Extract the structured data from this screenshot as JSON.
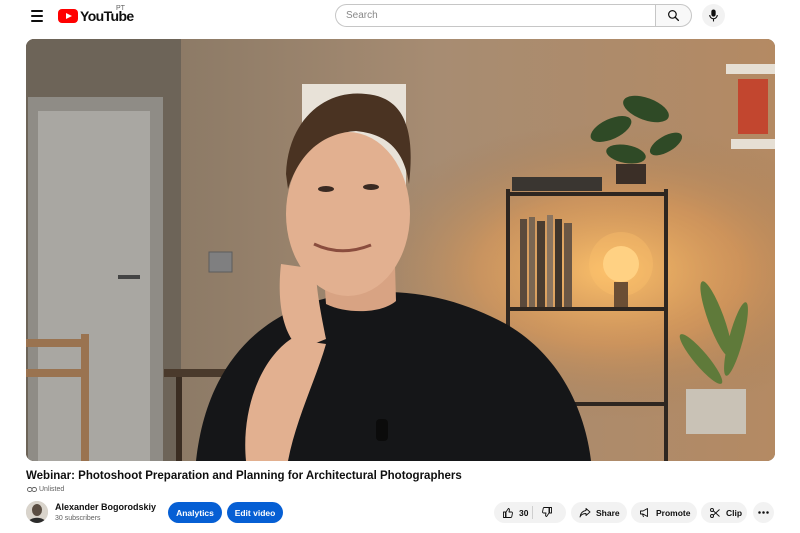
{
  "header": {
    "logo_text": "YouTube",
    "region_code": "PT",
    "search_placeholder": "Search"
  },
  "video": {
    "title": "Webinar: Photoshoot Preparation and Planning for Architectural Photographers",
    "visibility": "Unlisted"
  },
  "channel": {
    "name": "Alexander Bogorodskiy",
    "subscribers": "30 subscribers"
  },
  "actions": {
    "analytics_label": "Analytics",
    "edit_label": "Edit video",
    "like_count": "30",
    "share_label": "Share",
    "promote_label": "Promote",
    "clip_label": "Clip"
  },
  "colors": {
    "brand_red": "#ff0000",
    "accent_blue": "#065fd4",
    "chip_grey": "#f2f2f2"
  },
  "icons": [
    "menu-icon",
    "youtube-logo-icon",
    "search-icon",
    "mic-icon",
    "link-icon",
    "thumbs-up-icon",
    "thumbs-down-icon",
    "share-icon",
    "promote-icon",
    "scissors-icon",
    "more-icon"
  ]
}
